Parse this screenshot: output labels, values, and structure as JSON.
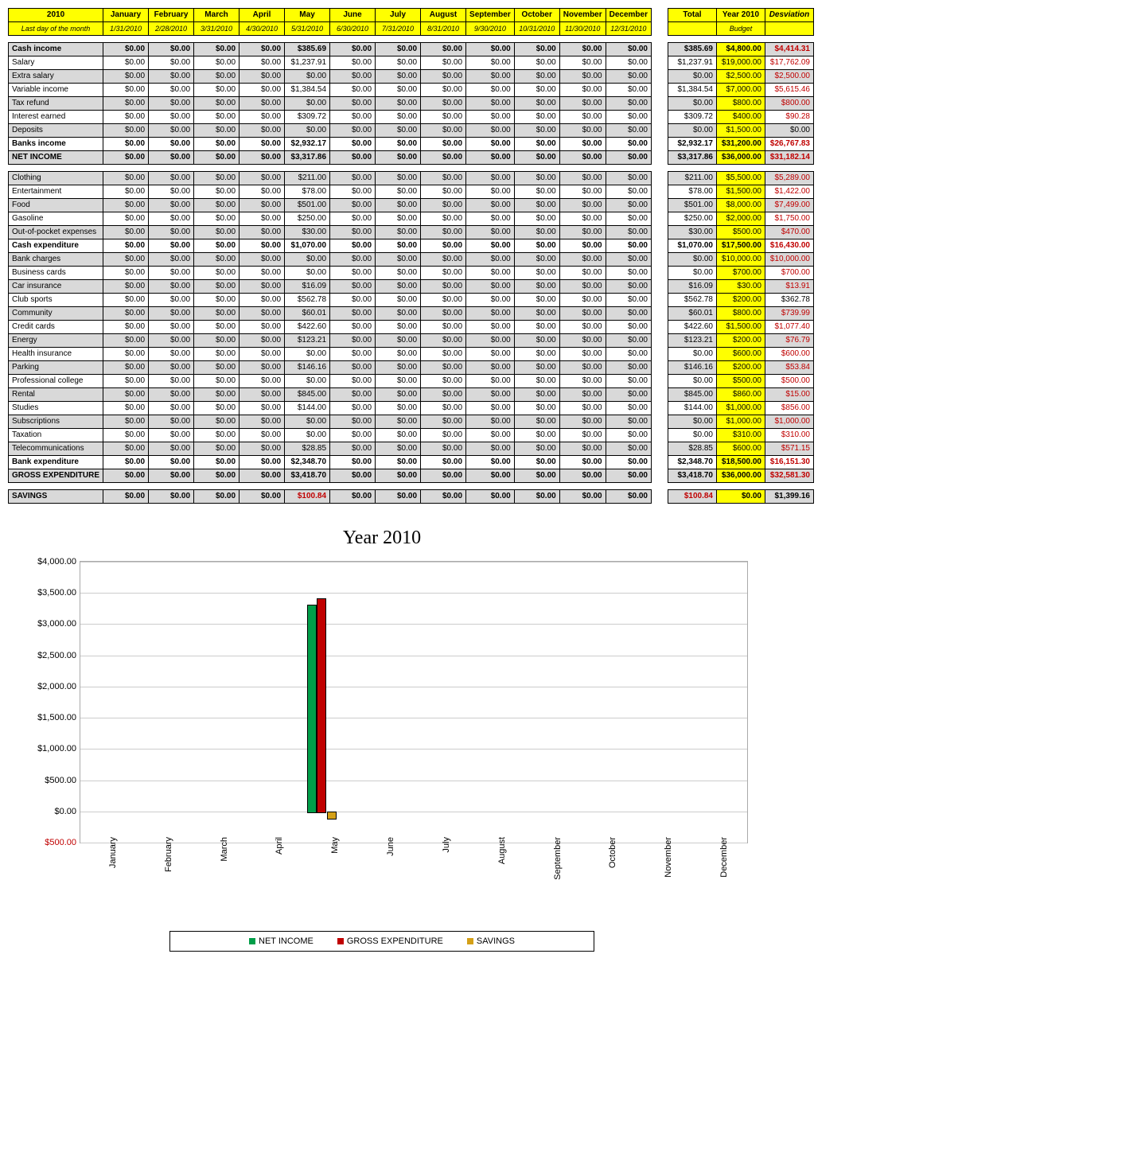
{
  "header": {
    "year": "2010",
    "subtitle": "Last day of the month",
    "months": [
      "January",
      "February",
      "March",
      "April",
      "May",
      "June",
      "July",
      "August",
      "September",
      "October",
      "November",
      "December"
    ],
    "dates": [
      "1/31/2010",
      "2/28/2010",
      "3/31/2010",
      "4/30/2010",
      "5/31/2010",
      "6/30/2010",
      "7/31/2010",
      "8/31/2010",
      "9/30/2010",
      "10/31/2010",
      "11/30/2010",
      "12/31/2010"
    ],
    "total_hdr": "Total",
    "budget_hdr": "Year 2010",
    "budget_sub": "Budget",
    "dev_hdr": "Desviation"
  },
  "rows": [
    {
      "label": "Cash income",
      "may": "$385.69",
      "total": "$385.69",
      "budget": "$4,800.00",
      "dev": "$4,414.31",
      "style": "grey bold",
      "devred": true
    },
    {
      "label": "Salary",
      "may": "$1,237.91",
      "total": "$1,237.91",
      "budget": "$19,000.00",
      "dev": "$17,762.09",
      "style": "white",
      "devred": true
    },
    {
      "label": "Extra salary",
      "may": "$0.00",
      "total": "$0.00",
      "budget": "$2,500.00",
      "dev": "$2,500.00",
      "style": "grey",
      "devred": true
    },
    {
      "label": "Variable income",
      "may": "$1,384.54",
      "total": "$1,384.54",
      "budget": "$7,000.00",
      "dev": "$5,615.46",
      "style": "white",
      "devred": true
    },
    {
      "label": "Tax refund",
      "may": "$0.00",
      "total": "$0.00",
      "budget": "$800.00",
      "dev": "$800.00",
      "style": "grey",
      "devred": true
    },
    {
      "label": "Interest earned",
      "may": "$309.72",
      "total": "$309.72",
      "budget": "$400.00",
      "dev": "$90.28",
      "style": "white",
      "devred": true
    },
    {
      "label": "Deposits",
      "may": "$0.00",
      "total": "$0.00",
      "budget": "$1,500.00",
      "dev": "$0.00",
      "style": "grey",
      "devred": false
    },
    {
      "label": "Banks income",
      "may": "$2,932.17",
      "total": "$2,932.17",
      "budget": "$31,200.00",
      "dev": "$26,767.83",
      "style": "white bold",
      "devred": true
    },
    {
      "label": "NET INCOME",
      "may": "$3,317.86",
      "total": "$3,317.86",
      "budget": "$36,000.00",
      "dev": "$31,182.14",
      "style": "grey bold",
      "devred": true,
      "budgetbold": true
    },
    {
      "spacer": true
    },
    {
      "label": "Clothing",
      "may": "$211.00",
      "total": "$211.00",
      "budget": "$5,500.00",
      "dev": "$5,289.00",
      "style": "grey",
      "devred": true
    },
    {
      "label": "Entertainment",
      "may": "$78.00",
      "total": "$78.00",
      "budget": "$1,500.00",
      "dev": "$1,422.00",
      "style": "white",
      "devred": true
    },
    {
      "label": "Food",
      "may": "$501.00",
      "total": "$501.00",
      "budget": "$8,000.00",
      "dev": "$7,499.00",
      "style": "grey",
      "devred": true
    },
    {
      "label": "Gasoline",
      "may": "$250.00",
      "total": "$250.00",
      "budget": "$2,000.00",
      "dev": "$1,750.00",
      "style": "white",
      "devred": true
    },
    {
      "label": "Out-of-pocket expenses",
      "may": "$30.00",
      "total": "$30.00",
      "budget": "$500.00",
      "dev": "$470.00",
      "style": "grey",
      "devred": true
    },
    {
      "label": "Cash expenditure",
      "may": "$1,070.00",
      "total": "$1,070.00",
      "budget": "$17,500.00",
      "dev": "$16,430.00",
      "style": "white bold",
      "devred": true
    },
    {
      "label": "Bank charges",
      "may": "$0.00",
      "total": "$0.00",
      "budget": "$10,000.00",
      "dev": "$10,000.00",
      "style": "grey",
      "devred": true
    },
    {
      "label": "Business cards",
      "may": "$0.00",
      "total": "$0.00",
      "budget": "$700.00",
      "dev": "$700.00",
      "style": "white",
      "devred": true
    },
    {
      "label": "Car insurance",
      "may": "$16.09",
      "total": "$16.09",
      "budget": "$30.00",
      "dev": "$13.91",
      "style": "grey",
      "devred": true
    },
    {
      "label": "Club sports",
      "may": "$562.78",
      "total": "$562.78",
      "budget": "$200.00",
      "dev": "$362.78",
      "style": "white",
      "devred": false
    },
    {
      "label": "Community",
      "may": "$60.01",
      "total": "$60.01",
      "budget": "$800.00",
      "dev": "$739.99",
      "style": "grey",
      "devred": true
    },
    {
      "label": "Credit cards",
      "may": "$422.60",
      "total": "$422.60",
      "budget": "$1,500.00",
      "dev": "$1,077.40",
      "style": "white",
      "devred": true
    },
    {
      "label": "Energy",
      "may": "$123.21",
      "total": "$123.21",
      "budget": "$200.00",
      "dev": "$76.79",
      "style": "grey",
      "devred": true
    },
    {
      "label": "Health insurance",
      "may": "$0.00",
      "total": "$0.00",
      "budget": "$600.00",
      "dev": "$600.00",
      "style": "white",
      "devred": true
    },
    {
      "label": "Parking",
      "may": "$146.16",
      "total": "$146.16",
      "budget": "$200.00",
      "dev": "$53.84",
      "style": "grey",
      "devred": true
    },
    {
      "label": "Professional college",
      "may": "$0.00",
      "total": "$0.00",
      "budget": "$500.00",
      "dev": "$500.00",
      "style": "white",
      "devred": true
    },
    {
      "label": "Rental",
      "may": "$845.00",
      "total": "$845.00",
      "budget": "$860.00",
      "dev": "$15.00",
      "style": "grey",
      "devred": true
    },
    {
      "label": "Studies",
      "may": "$144.00",
      "total": "$144.00",
      "budget": "$1,000.00",
      "dev": "$856.00",
      "style": "white",
      "devred": true
    },
    {
      "label": "Subscriptions",
      "may": "$0.00",
      "total": "$0.00",
      "budget": "$1,000.00",
      "dev": "$1,000.00",
      "style": "grey",
      "devred": true
    },
    {
      "label": "Taxation",
      "may": "$0.00",
      "total": "$0.00",
      "budget": "$310.00",
      "dev": "$310.00",
      "style": "white",
      "devred": true
    },
    {
      "label": "Telecommunications",
      "may": "$28.85",
      "total": "$28.85",
      "budget": "$600.00",
      "dev": "$571.15",
      "style": "grey",
      "devred": true
    },
    {
      "label": "Bank expenditure",
      "may": "$2,348.70",
      "total": "$2,348.70",
      "budget": "$18,500.00",
      "dev": "$16,151.30",
      "style": "white bold",
      "devred": true
    },
    {
      "label": "GROSS EXPENDITURE",
      "may": "$3,418.70",
      "total": "$3,418.70",
      "budget": "$36,000.00",
      "dev": "$32,581.30",
      "style": "grey bold",
      "devred": true,
      "budgetbold": true
    },
    {
      "spacer": true
    },
    {
      "label": "SAVINGS",
      "may": "$100.84",
      "total": "$100.84",
      "budget": "$0.00",
      "dev": "$1,399.16",
      "style": "grey bold",
      "mayred": true,
      "totalred": true,
      "budgetbold": true
    }
  ],
  "zero": "$0.00",
  "chart_data": {
    "type": "bar",
    "title": "Year 2010",
    "categories": [
      "January",
      "February",
      "March",
      "April",
      "May",
      "June",
      "July",
      "August",
      "September",
      "October",
      "November",
      "December"
    ],
    "series": [
      {
        "name": "NET INCOME",
        "color": "#009e49",
        "values": [
          0,
          0,
          0,
          0,
          3317.86,
          0,
          0,
          0,
          0,
          0,
          0,
          0
        ]
      },
      {
        "name": "GROSS EXPENDITURE",
        "color": "#c00000",
        "values": [
          0,
          0,
          0,
          0,
          3418.7,
          0,
          0,
          0,
          0,
          0,
          0,
          0
        ]
      },
      {
        "name": "SAVINGS",
        "color": "#d4a017",
        "values": [
          0,
          0,
          0,
          0,
          -100.84,
          0,
          0,
          0,
          0,
          0,
          0,
          0
        ]
      }
    ],
    "ylim": [
      -500,
      4000
    ],
    "yticks": [
      -500,
      0,
      500,
      1000,
      1500,
      2000,
      2500,
      3000,
      3500,
      4000
    ],
    "yticklabels": [
      "$500.00",
      "$0.00",
      "$500.00",
      "$1,000.00",
      "$1,500.00",
      "$2,000.00",
      "$2,500.00",
      "$3,000.00",
      "$3,500.00",
      "$4,000.00"
    ]
  }
}
